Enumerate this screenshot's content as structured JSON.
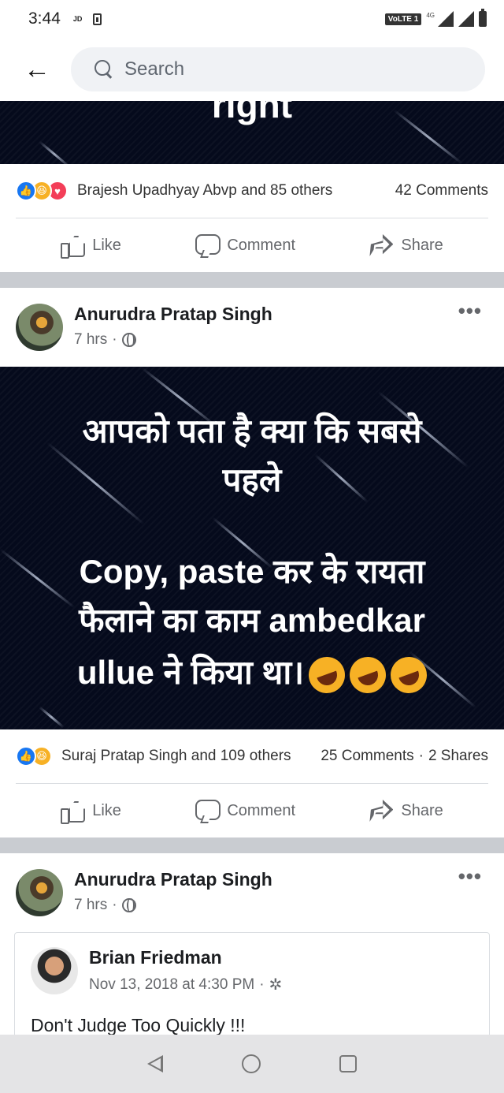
{
  "status_bar": {
    "time": "3:44",
    "carrier_label": "JD",
    "volte_label": "VoLTE 1",
    "network_label": "4G"
  },
  "search": {
    "placeholder": "Search"
  },
  "post_prev": {
    "image_text": "right",
    "reactions_text": "Brajesh Upadhyay Abvp and 85 others",
    "comments_text": "42 Comments"
  },
  "actions": {
    "like": "Like",
    "comment": "Comment",
    "share": "Share"
  },
  "post1": {
    "author": "Anurudra Pratap Singh",
    "time": "7 hrs",
    "meme_lines": [
      "आपको पता है क्या कि सबसे",
      "पहले",
      "",
      "Copy, paste कर के रायता",
      "फैलाने का काम ambedkar",
      "ullue ने किया था।"
    ],
    "reactions_text": "Suraj Pratap Singh and 109 others",
    "comments_text": "25 Comments",
    "shares_text": "2 Shares"
  },
  "post2": {
    "author": "Anurudra Pratap Singh",
    "time": "7 hrs",
    "shared": {
      "author": "Brian Friedman",
      "time": "Nov 13, 2018 at 4:30 PM",
      "text": "Don't Judge Too Quickly !!!"
    }
  },
  "colors": {
    "brand_blue": "#1877f2",
    "haha_yellow": "#f7b125",
    "love_red": "#f33e58",
    "meme_background": "#050a1c"
  }
}
